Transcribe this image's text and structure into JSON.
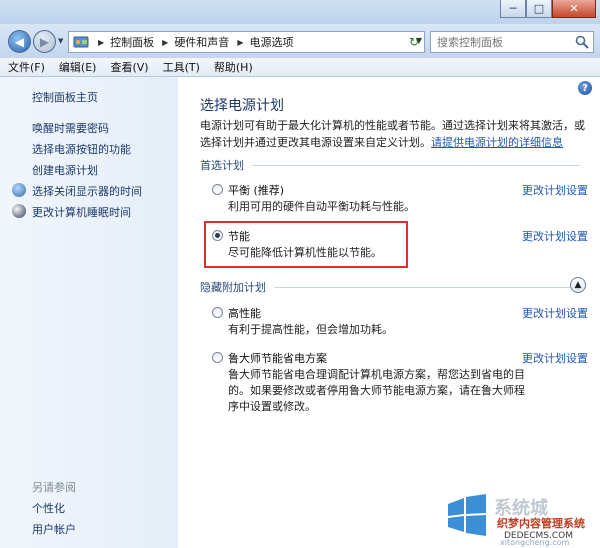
{
  "window": {
    "minimize_glyph": "─",
    "maximize_glyph": "□",
    "close_glyph": "✕"
  },
  "address": {
    "crumbs": [
      "控制面板",
      "硬件和声音",
      "电源选项"
    ],
    "search_placeholder": "搜索控制面板"
  },
  "menu": {
    "items": [
      "文件(F)",
      "编辑(E)",
      "查看(V)",
      "工具(T)",
      "帮助(H)"
    ]
  },
  "sidebar": {
    "items": [
      {
        "label": "控制面板主页",
        "icon": null
      },
      {
        "label": "唤醒时需要密码",
        "icon": null
      },
      {
        "label": "选择电源按钮的功能",
        "icon": null
      },
      {
        "label": "创建电源计划",
        "icon": null
      },
      {
        "label": "选择关闭显示器的时间",
        "icon": "monitor-icon"
      },
      {
        "label": "更改计算机睡眠时间",
        "icon": "moon-icon"
      }
    ],
    "see_also": "另请参阅",
    "see_also_items": [
      "个性化",
      "用户帐户"
    ]
  },
  "main": {
    "title": "选择电源计划",
    "intro": "电源计划可有助于最大化计算机的性能或者节能。通过选择计划来将其激活，或选择计划并通过更改其电源设置来自定义计划。",
    "intro_link": "请提供电源计划的详细信息",
    "preferred_header": "首选计划",
    "hidden_header": "隐藏附加计划",
    "plans": [
      {
        "name": "平衡 (推荐)",
        "desc": "利用可用的硬件自动平衡功耗与性能。",
        "link": "更改计划设置",
        "checked": false
      },
      {
        "name": "节能",
        "desc": "尽可能降低计算机性能以节能。",
        "link": "更改计划设置",
        "checked": true
      },
      {
        "name": "高性能",
        "desc": "有利于提高性能，但会增加功耗。",
        "link": "更改计划设置",
        "checked": false
      },
      {
        "name": "鲁大师节能省电方案",
        "desc": "鲁大师节能省电合理调配计算机电源方案，帮您达到省电的目的。如果要修改或者停用鲁大师节能电源方案，请在鲁大师程序中设置或修改。",
        "link": "更改计划设置",
        "checked": false
      }
    ],
    "help_glyph": "?"
  },
  "watermark": {
    "brand": "系统城",
    "site": "织梦内容管理系统",
    "domain": "DEDECMS.COM",
    "url": "xitongcheng.com"
  },
  "colors": {
    "highlight_border": "#d7322e",
    "link": "#1f57b5",
    "title": "#1c3a6a"
  }
}
